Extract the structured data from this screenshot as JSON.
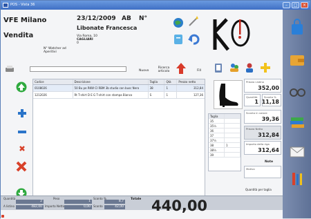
{
  "window": {
    "title": "POS - Vista 36"
  },
  "header": {
    "store": "VFE Milano",
    "mode": "Vendita",
    "date": "23/12/2009",
    "code": "AB",
    "number_label": "N°",
    "customer": "Libonate Francesca",
    "address_line1": "Via Roma, 10",
    "address_line2": "CAGLIARI",
    "address_line3": "0",
    "holder_line1": "N° Watcher ad",
    "holder_line2": "Aperitivi"
  },
  "toolbar": {
    "new_label": "Nuovo",
    "search_label": "Ricerca articolo",
    "fill_label": "Fill"
  },
  "grid": {
    "columns": [
      "Codice",
      "Descrizione",
      "Taglia",
      "Qtà",
      "Prezzo netto"
    ],
    "rows": [
      [
        "0108026",
        "50 Bu pe RKW CI RBM 3b studio con busc Nero",
        "38",
        "1",
        "312,84"
      ],
      [
        "1212026",
        "Rt T-shirt D E G T-shirt con stampa Bianco",
        "S",
        "1",
        "127,36"
      ]
    ]
  },
  "sizes": {
    "header": "Taglia",
    "rows": [
      [
        "35",
        ""
      ],
      [
        "35½",
        ""
      ],
      [
        "36",
        ""
      ],
      [
        "37",
        ""
      ],
      [
        "37½",
        ""
      ],
      [
        "38",
        "1"
      ],
      [
        "38½",
        ""
      ],
      [
        "39",
        ""
      ]
    ]
  },
  "price_panel": {
    "list_price_label": "Prezzo Listino",
    "list_price": "352,00",
    "quantity_label": "Quantità",
    "quantity": "1",
    "discount_label": "Sconto %",
    "discount": "11,18",
    "discount_value_label": "Sconto in valore",
    "discount_value": "39,36",
    "net_price_label": "Prezzo Netto",
    "net_price": "312,84",
    "row_total_label": "Importo della riga",
    "row_total": "312,64",
    "notes_label": "Note",
    "reason_label": "Motivo",
    "qty_per_size_label": "Quantità per taglia"
  },
  "footer": {
    "quantity_label": "Quantità",
    "quantity": "2",
    "weight_label": "Peso",
    "weight": "1",
    "discount_pct_label": "Sconto %",
    "discount_pct": "8,7",
    "gross_label": "A listino",
    "gross": "482,00",
    "tax_label": "Importo Netto",
    "tax": "0,00",
    "discount_label": "Sconto",
    "discount": "42,00",
    "total_label": "Totale",
    "total": "440,00"
  },
  "colors": {
    "accent": "#3f6fc4",
    "sidebar": "#6b7c9f",
    "green": "#2faa3f",
    "red": "#d8412a",
    "blue_plus": "#2a74c9"
  }
}
